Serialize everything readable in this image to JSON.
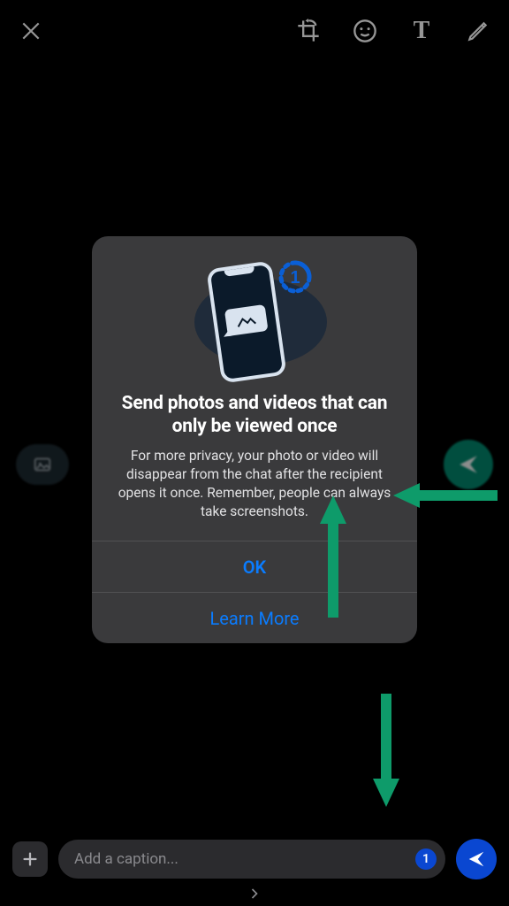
{
  "toolbar": {
    "close_icon": "close",
    "crop_icon": "crop-rotate",
    "emoji_icon": "emoji",
    "text_icon": "T",
    "draw_icon": "pencil"
  },
  "modal": {
    "title": "Send photos and videos that can only be viewed once",
    "description": "For more privacy, your photo or video will disappear from the chat after the recipient opens it once. Remember, people can always take screenshots.",
    "ok_label": "OK",
    "learn_more_label": "Learn More",
    "badge_number": "1"
  },
  "caption": {
    "placeholder": "Add a caption...",
    "viewonce_badge": "1"
  },
  "colors": {
    "accent_green": "#0e9b6a",
    "link_blue": "#0a7cff",
    "send_blue": "#0a47d1"
  }
}
